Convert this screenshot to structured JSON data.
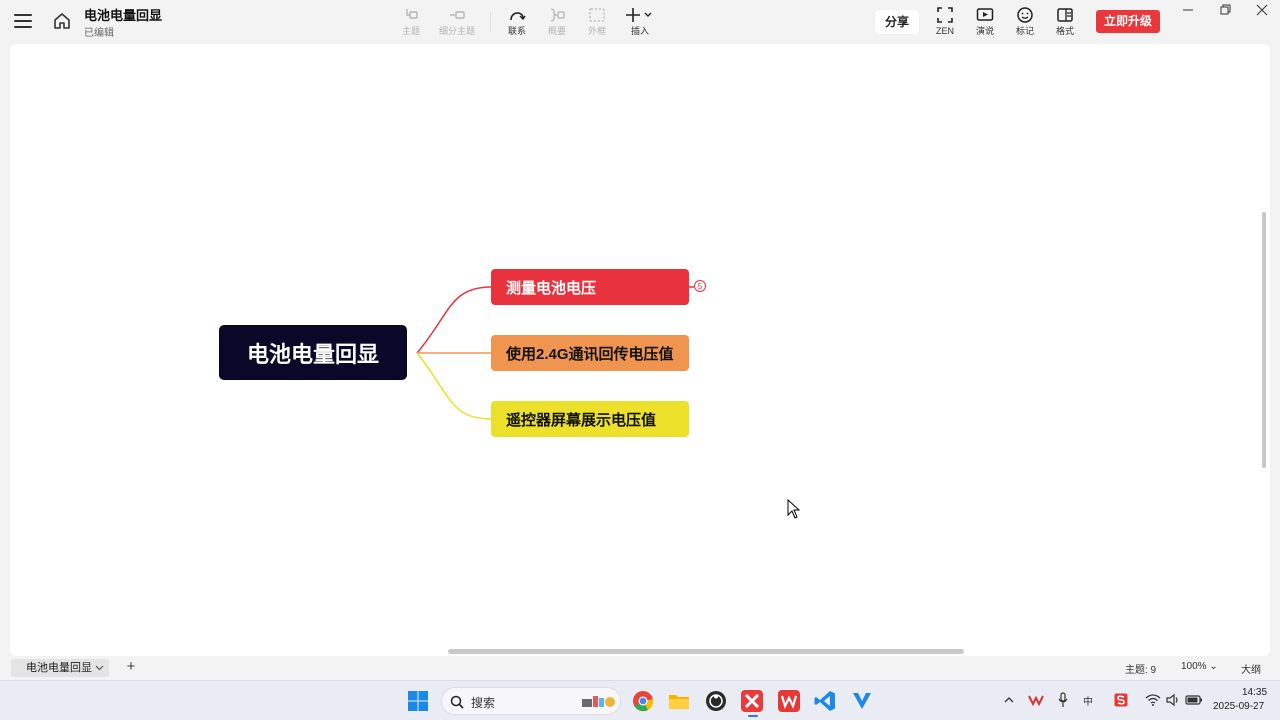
{
  "app": {
    "doc_title": "电池电量回显",
    "doc_status": "已编辑"
  },
  "toolbar": {
    "topic": "主题",
    "subtopic": "细分主题",
    "relation": "联系",
    "summary": "概要",
    "boundary": "外框",
    "insert": "插入",
    "share": "分享",
    "zen": "ZEN",
    "present": "演说",
    "marker": "标记",
    "format": "格式",
    "upgrade": "立即升级"
  },
  "mindmap": {
    "root": "电池电量回显",
    "children": [
      {
        "label": "测量电池电压",
        "color": "#e8323e",
        "collapsed_count": "5"
      },
      {
        "label": "使用2.4G通讯回传电压值",
        "color": "#f09550"
      },
      {
        "label": "遥控器屏幕展示电压值",
        "color": "#ece02a"
      }
    ]
  },
  "statusbar": {
    "sheet_name": "电池电量回显",
    "topic_count": "主题: 9",
    "zoom": "100%",
    "outline": "大纲"
  },
  "taskbar": {
    "search_placeholder": "搜索",
    "ime_label": "中",
    "time": "14:35",
    "date": "2025-09-27"
  }
}
